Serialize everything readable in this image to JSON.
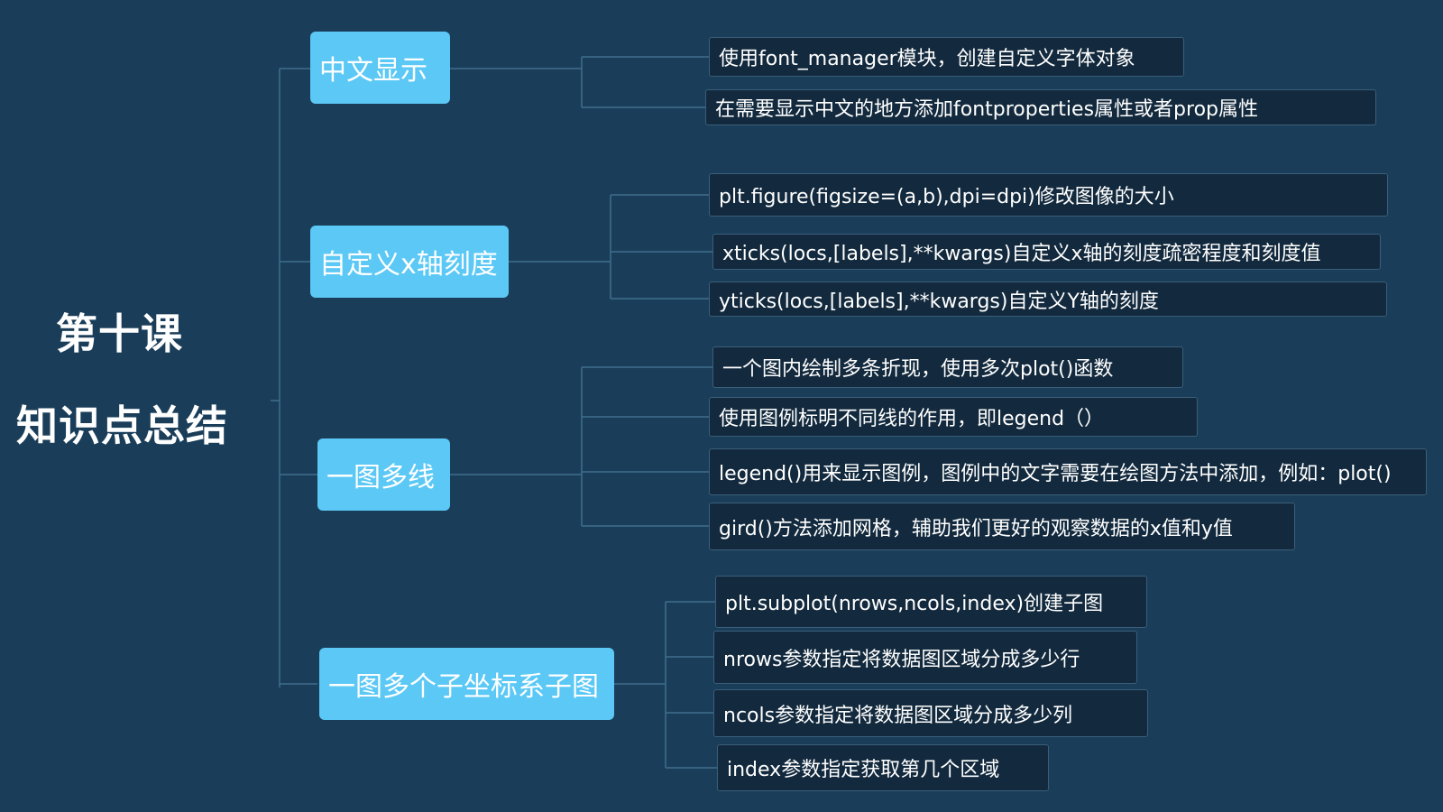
{
  "root": {
    "title": "第十课",
    "subtitle": "知识点总结"
  },
  "branches": [
    {
      "label": "中文显示",
      "children": [
        "使用font_manager模块，创建自定义字体对象",
        "在需要显示中文的地方添加fontproperties属性或者prop属性"
      ]
    },
    {
      "label": "自定义x轴刻度",
      "children": [
        "plt.figure(figsize=(a,b),dpi=dpi)修改图像的大小",
        "xticks(locs,[labels],**kwargs)自定义x轴的刻度疏密程度和刻度值",
        "yticks(locs,[labels],**kwargs)自定义Y轴的刻度"
      ]
    },
    {
      "label": "一图多线",
      "children": [
        "一个图内绘制多条折现，使用多次plot()函数",
        "使用图例标明不同线的作用，即legend（）",
        "legend()用来显示图例，图例中的文字需要在绘图方法中添加，例如：plot()",
        "gird()方法添加网格，辅助我们更好的观察数据的x值和y值"
      ]
    },
    {
      "label": "一图多个子坐标系子图",
      "children": [
        "plt.subplot(nrows,ncols,index)创建子图",
        "nrows参数指定将数据图区域分成多少行",
        "ncols参数指定将数据图区域分成多少列",
        "index参数指定获取第几个区域"
      ]
    }
  ],
  "colors": {
    "background": "#1a3e5a",
    "branch_fill": "#5bc8f5",
    "leaf_fill": "#132a3e",
    "leaf_border": "#3a5e7a",
    "connector": "#3f6e8c"
  }
}
